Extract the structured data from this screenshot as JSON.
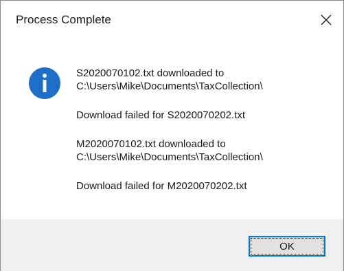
{
  "window": {
    "title": "Process Complete",
    "close_icon": "close-icon"
  },
  "dialog": {
    "icon": "info-icon",
    "messages": [
      {
        "lines": [
          "S2020070102.txt downloaded to",
          "C:\\Users\\Mike\\Documents\\TaxCollection\\"
        ]
      },
      {
        "lines": [
          "Download failed for S2020070202.txt"
        ]
      },
      {
        "lines": [
          "M2020070102.txt downloaded to",
          "C:\\Users\\Mike\\Documents\\TaxCollection\\"
        ]
      },
      {
        "lines": [
          "Download failed for M2020070202.txt"
        ]
      }
    ]
  },
  "footer": {
    "ok_label": "OK"
  },
  "colors": {
    "accent": "#0078d7",
    "footer_bg": "#f0f0f0",
    "info_icon_blue": "#1d6fc9"
  }
}
